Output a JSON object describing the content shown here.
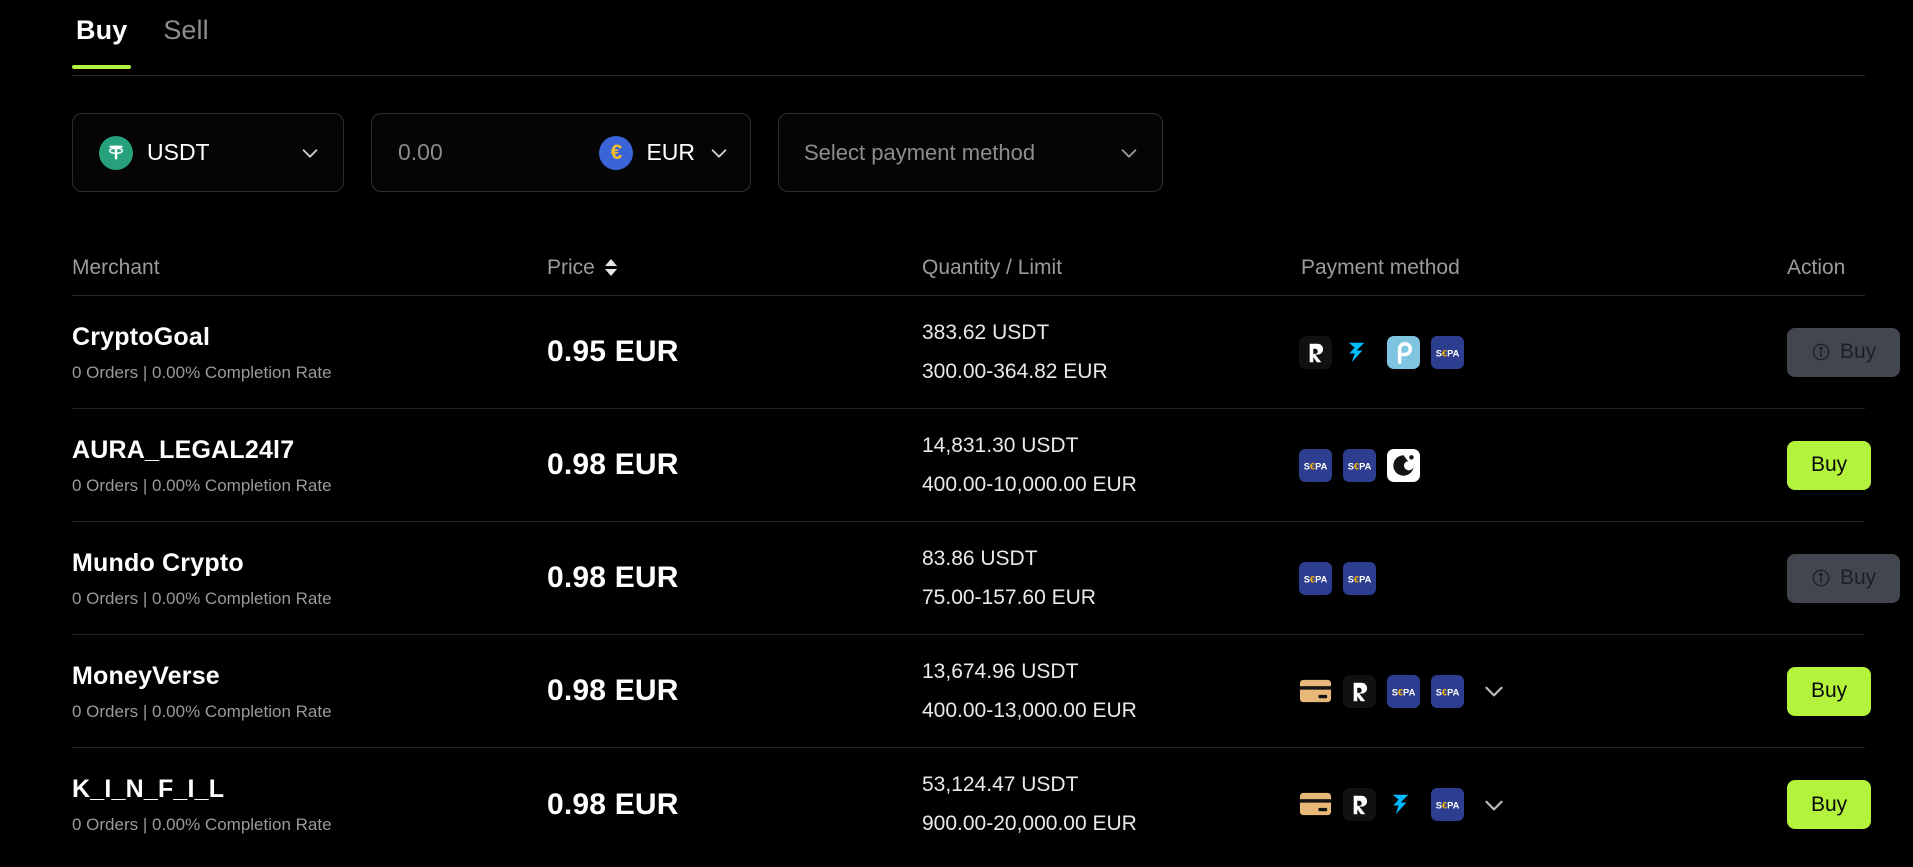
{
  "tabs": [
    {
      "label": "Buy",
      "active": true
    },
    {
      "label": "Sell",
      "active": false
    }
  ],
  "filters": {
    "coin": {
      "symbol": "USDT",
      "icon": "tether-icon",
      "accent": "#26a17b"
    },
    "amount": {
      "value": "",
      "placeholder": "0.00"
    },
    "fiat": {
      "symbol": "EUR",
      "icon": "euro-icon",
      "accent": "#3a63d8",
      "glyph": "€"
    },
    "payment_method": {
      "placeholder": "Select payment method"
    }
  },
  "table": {
    "headers": {
      "merchant": "Merchant",
      "price": "Price",
      "quantity_limit": "Quantity / Limit",
      "payment_method": "Payment method",
      "action": "Action"
    },
    "sort": {
      "column": "price",
      "icon": "sort-updown-icon"
    },
    "rows": [
      {
        "merchant": "CryptoGoal",
        "meta": "0 Orders | 0.00% Completion Rate",
        "price": "0.95 EUR",
        "quantity": "383.62 USDT",
        "limit": "300.00-364.82 EUR",
        "payment_icons": [
          "revolut",
          "wise",
          "paysera",
          "sepa"
        ],
        "has_more": false,
        "action": {
          "label": "Buy",
          "enabled": false,
          "icon": "info-icon"
        }
      },
      {
        "merchant": "AURA_LEGAL24l7",
        "meta": "0 Orders | 0.00% Completion Rate",
        "price": "0.98 EUR",
        "quantity": "14,831.30 USDT",
        "limit": "400.00-10,000.00 EUR",
        "payment_icons": [
          "sepa",
          "sepa",
          "monzo"
        ],
        "has_more": false,
        "action": {
          "label": "Buy",
          "enabled": true,
          "icon": null
        }
      },
      {
        "merchant": "Mundo Crypto",
        "meta": "0 Orders | 0.00% Completion Rate",
        "price": "0.98 EUR",
        "quantity": "83.86 USDT",
        "limit": "75.00-157.60 EUR",
        "payment_icons": [
          "sepa",
          "sepa"
        ],
        "has_more": false,
        "action": {
          "label": "Buy",
          "enabled": false,
          "icon": "info-icon"
        }
      },
      {
        "merchant": "MoneyVerse",
        "meta": "0 Orders | 0.00% Completion Rate",
        "price": "0.98 EUR",
        "quantity": "13,674.96 USDT",
        "limit": "400.00-13,000.00 EUR",
        "payment_icons": [
          "bank-card",
          "revolut",
          "sepa",
          "sepa"
        ],
        "has_more": true,
        "action": {
          "label": "Buy",
          "enabled": true,
          "icon": null
        }
      },
      {
        "merchant": "K_I_N_F_I_L",
        "meta": "0 Orders | 0.00% Completion Rate",
        "price": "0.98 EUR",
        "quantity": "53,124.47 USDT",
        "limit": "900.00-20,000.00 EUR",
        "payment_icons": [
          "bank-card",
          "revolut",
          "wise",
          "sepa"
        ],
        "has_more": true,
        "action": {
          "label": "Buy",
          "enabled": true,
          "icon": null
        }
      }
    ]
  },
  "colors": {
    "background": "#000000",
    "accent_green": "#b3f23d",
    "tether_green": "#26a17b",
    "sepa_blue": "#2d3d8f",
    "wise_blue": "#00b9ff",
    "paysera_blue": "#7fc4e0",
    "card_tan": "#e8b878",
    "disabled_button": "#42464f",
    "muted_text": "#9a9a9a"
  }
}
